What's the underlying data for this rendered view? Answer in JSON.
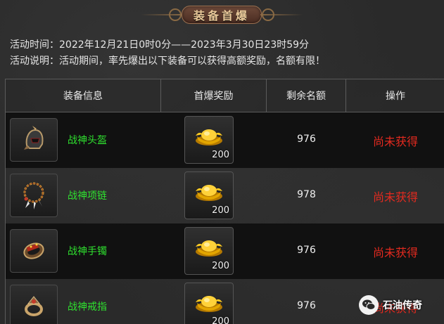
{
  "header": {
    "title": "装备首爆"
  },
  "info": {
    "time_line": "活动时间：2022年12月21日0时0分——2023年3月30日23时59分",
    "desc_line": "活动说明：活动期间，率先爆出以下装备可以获得高额奖励，名额有限！"
  },
  "table": {
    "columns": [
      "装备信息",
      "首爆奖励",
      "剩余名额",
      "操作"
    ],
    "rows": [
      {
        "item_name": "战神头盔",
        "item_icon": "helmet-icon",
        "reward_count": "200",
        "remaining": "976",
        "action": "尚未获得"
      },
      {
        "item_name": "战神项链",
        "item_icon": "necklace-icon",
        "reward_count": "200",
        "remaining": "978",
        "action": "尚未获得"
      },
      {
        "item_name": "战神手镯",
        "item_icon": "bracelet-icon",
        "reward_count": "200",
        "remaining": "976",
        "action": "尚未获得"
      },
      {
        "item_name": "战神戒指",
        "item_icon": "ring-icon",
        "reward_count": "200",
        "remaining": "976",
        "action": "尚未获得"
      }
    ]
  },
  "reward_icon": "gold-ingot-icon",
  "watermark": {
    "text": "石油传奇",
    "icon": "wechat-icon"
  },
  "colors": {
    "item_name": "#2fe12f",
    "action": "#e42a1f",
    "banner": "#e9c99a"
  }
}
